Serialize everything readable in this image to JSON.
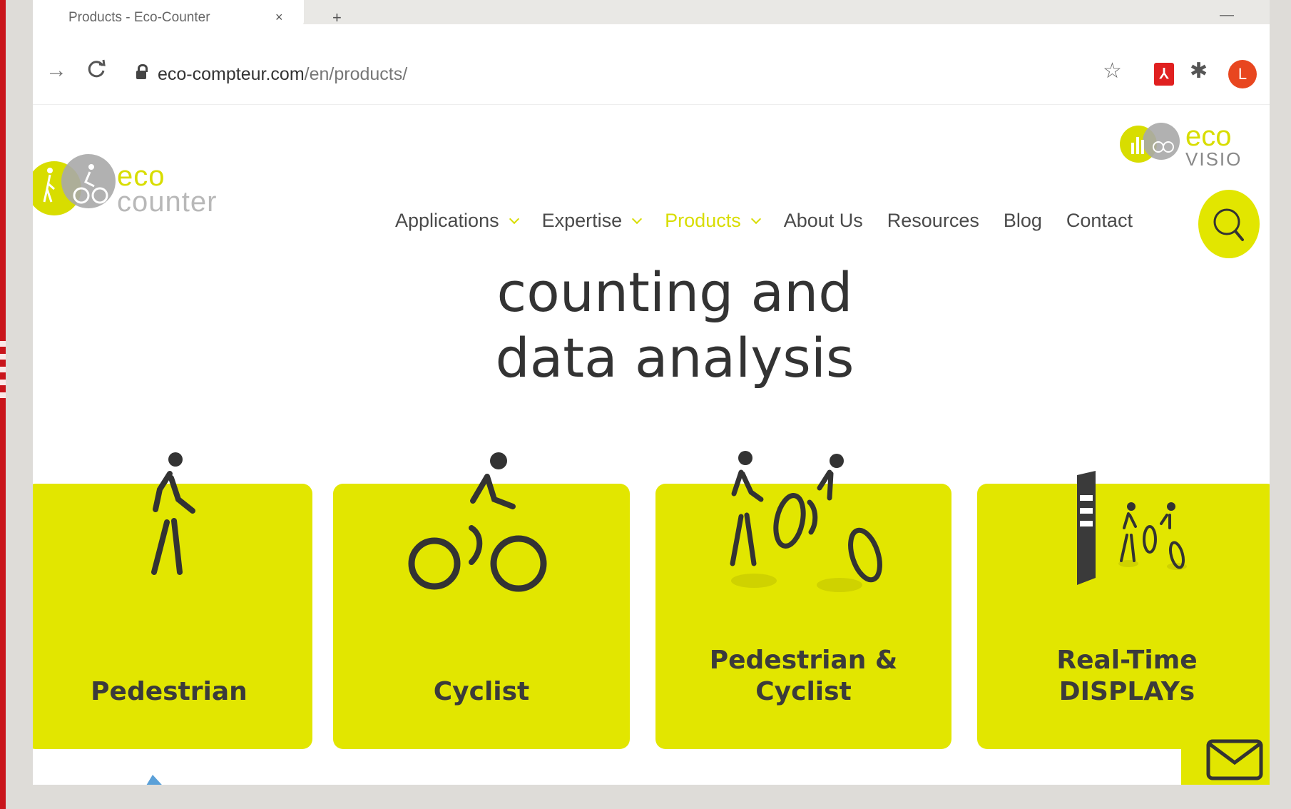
{
  "browser": {
    "tab_title": "Products - Eco-Counter",
    "tab_close": "×",
    "new_tab": "+",
    "url_host": "eco-compteur.com",
    "url_path": "/en/products/",
    "forward_icon": "→",
    "reload_icon": "C",
    "star_icon": "☆",
    "puzzle_icon": "✱",
    "pdf_icon": "⅄",
    "profile_initial": "L"
  },
  "site": {
    "logo": {
      "eco": "eco",
      "counter": "counter"
    },
    "ecovisio": {
      "eco": "eco",
      "visio": "VISIO"
    },
    "nav": [
      {
        "label": "Applications",
        "has_dropdown": true,
        "active": false
      },
      {
        "label": "Expertise",
        "has_dropdown": true,
        "active": false
      },
      {
        "label": "Products",
        "has_dropdown": true,
        "active": true
      },
      {
        "label": "About Us",
        "has_dropdown": false,
        "active": false
      },
      {
        "label": "Resources",
        "has_dropdown": false,
        "active": false
      },
      {
        "label": "Blog",
        "has_dropdown": false,
        "active": false
      },
      {
        "label": "Contact",
        "has_dropdown": false,
        "active": false
      }
    ],
    "hero": {
      "line1": "counting and",
      "line2": "data analysis"
    },
    "cards": [
      {
        "line1": "Pedestrian",
        "line2": "",
        "icon": "pedestrian-icon"
      },
      {
        "line1": "Cyclist",
        "line2": "",
        "icon": "cyclist-icon"
      },
      {
        "line1": "Pedestrian &",
        "line2": "Cyclist",
        "icon": "pedestrian-cyclist-icon"
      },
      {
        "line1": "Real-Time",
        "line2": "DISPLAYs",
        "icon": "display-totem-icon"
      }
    ]
  },
  "colors": {
    "accent": "#e2e600",
    "frame_red": "#c9141b",
    "text_dark": "#3b3b3b"
  }
}
